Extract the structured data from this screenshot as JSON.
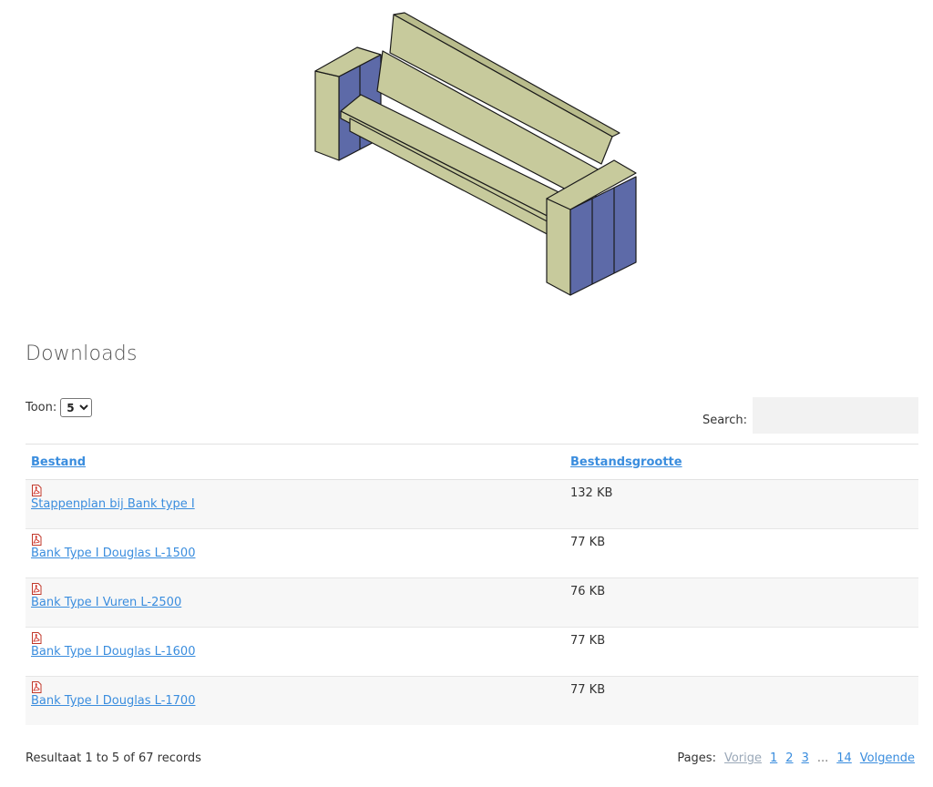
{
  "downloads": {
    "title": "Downloads",
    "length_label": "Toon:",
    "length_selected": "5",
    "search_label": "Search:",
    "search_value": "",
    "columns": [
      "Bestand",
      "Bestandsgrootte"
    ],
    "rows": [
      {
        "file": "Stappenplan bij Bank type I",
        "size": "132 KB"
      },
      {
        "file": "Bank Type I Douglas L-1500",
        "size": "77 KB"
      },
      {
        "file": "Bank Type I Vuren L-2500",
        "size": "76 KB"
      },
      {
        "file": "Bank Type I Douglas L-1600",
        "size": "77 KB"
      },
      {
        "file": "Bank Type I Douglas L-1700",
        "size": "77 KB"
      }
    ],
    "file_icon": "pdf-icon",
    "result_text": "Resultaat 1 to 5 of 67 records",
    "pager": {
      "label": "Pages:",
      "prev": "Vorige",
      "pages": [
        "1",
        "2",
        "3"
      ],
      "ellipsis": "...",
      "last": "14",
      "next": "Volgende"
    }
  },
  "colors": {
    "link": "#3a8dde",
    "wood_top": "#c7ca9c",
    "wood_side": "#5d6aa8"
  }
}
